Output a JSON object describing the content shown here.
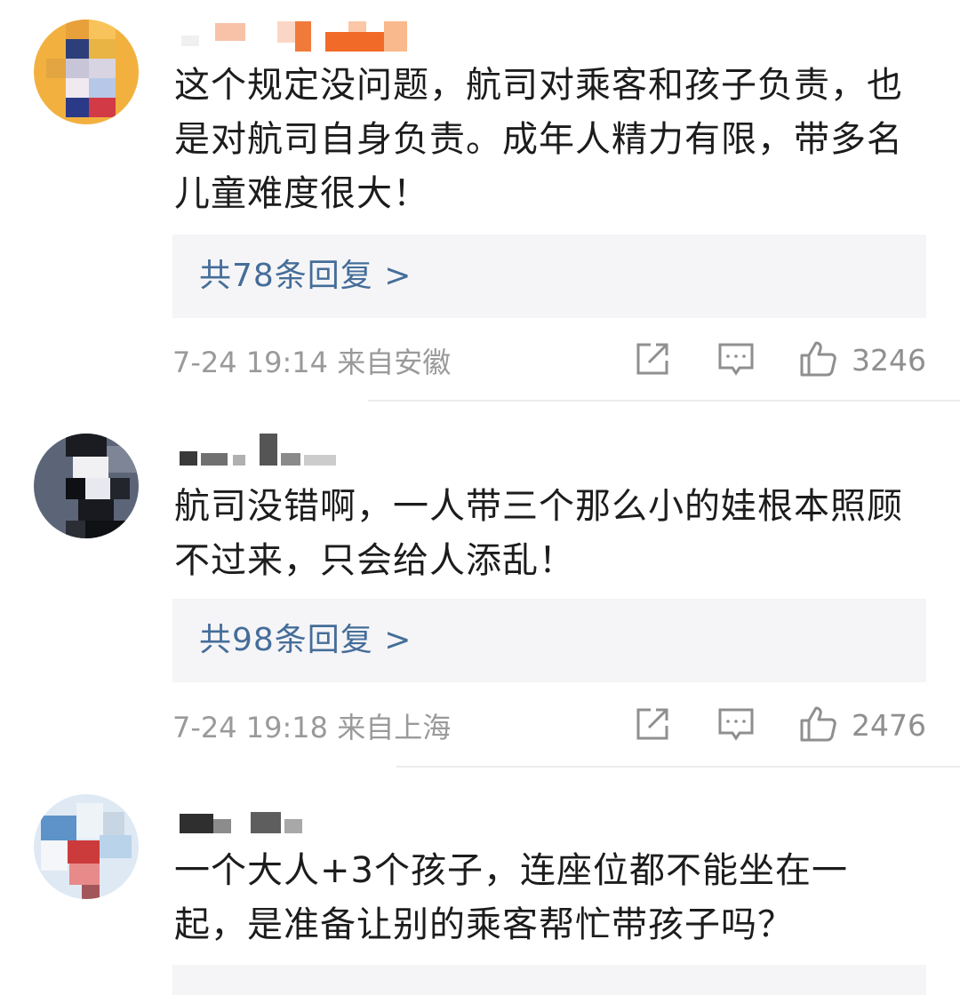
{
  "comments": [
    {
      "text": "这个规定没问题，航司对乘客和孩子负责，也是对航司自身负责。成年人精力有限，带多名儿童难度很大！",
      "replies_label": "共78条回复 >",
      "time_location": "7-24 19:14 来自安徽",
      "likes": "3246",
      "icons": [
        "share-icon",
        "comment-icon",
        "like-icon"
      ]
    },
    {
      "text": "航司没错啊，一人带三个那么小的娃根本照顾不过来，只会给人添乱！",
      "replies_label": "共98条回复 >",
      "time_location": "7-24 19:18 来自上海",
      "likes": "2476",
      "icons": [
        "share-icon",
        "comment-icon",
        "like-icon"
      ]
    },
    {
      "text": "一个大人+3个孩子，连座位都不能坐在一起，是准备让别的乘客帮忙带孩子吗？",
      "icons": []
    }
  ],
  "colors": {
    "reply_link": "#456d99",
    "meta_gray": "#9a9a9a",
    "reply_box_bg": "#f5f5f7",
    "divider": "#ececec"
  }
}
